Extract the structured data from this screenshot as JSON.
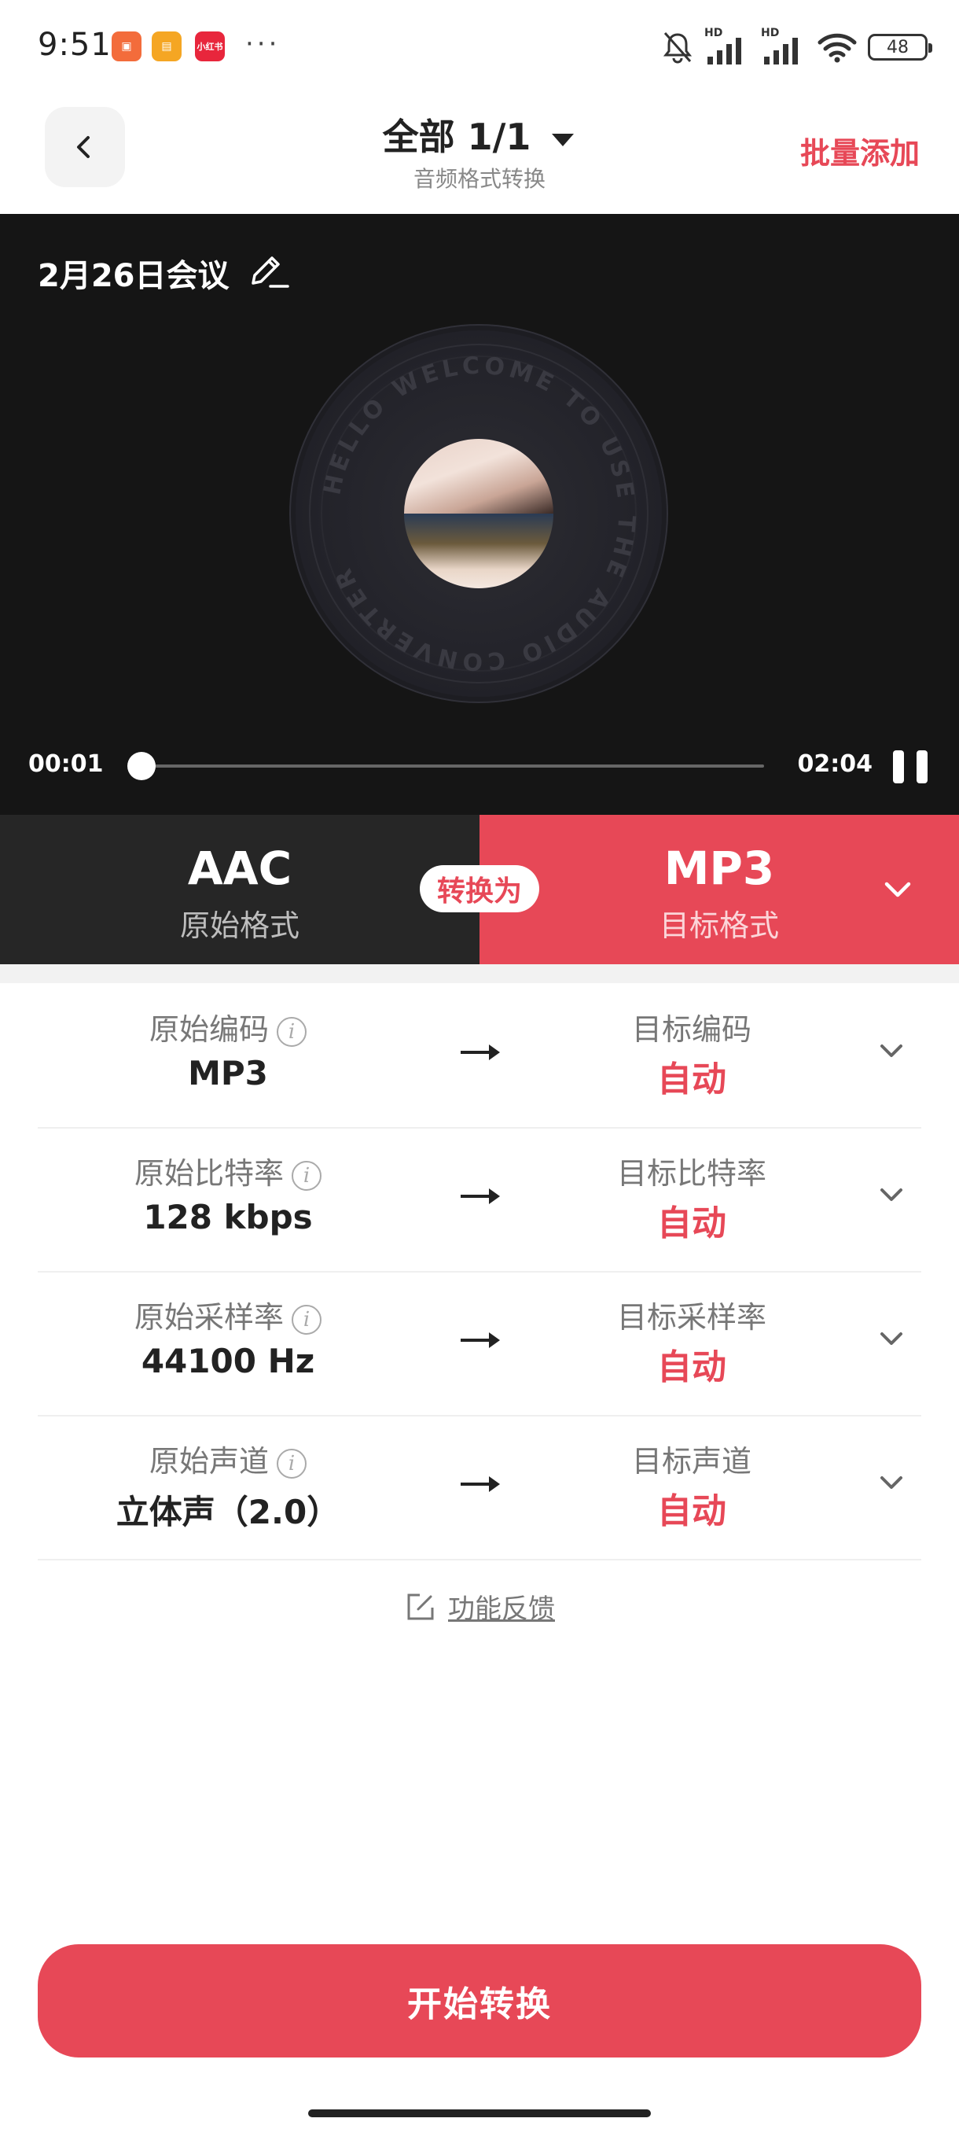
{
  "status": {
    "time": "9:51",
    "app_icon_badge": "小红书",
    "hd_label": "HD",
    "battery": "48"
  },
  "header": {
    "title": "全部 1/1",
    "subtitle": "音频格式转换",
    "batch_add": "批量添加"
  },
  "player": {
    "file_name": "2月26日会议",
    "disc_text": "HELLO WELCOME TO USE THE AUDIO CONVERTER",
    "time_current": "00:01",
    "time_total": "02:04",
    "progress_fraction": 0.008
  },
  "format": {
    "source_name": "AAC",
    "source_label": "原始格式",
    "convert_label": "转换为",
    "target_name": "MP3",
    "target_label": "目标格式"
  },
  "params": [
    {
      "label": "原始编码",
      "value": "MP3",
      "target_label": "目标编码",
      "target_value": "自动"
    },
    {
      "label": "原始比特率",
      "value": "128 kbps",
      "target_label": "目标比特率",
      "target_value": "自动"
    },
    {
      "label": "原始采样率",
      "value": "44100 Hz",
      "target_label": "目标采样率",
      "target_value": "自动"
    },
    {
      "label": "原始声道",
      "value": "立体声（2.0）",
      "target_label": "目标声道",
      "target_value": "自动"
    }
  ],
  "feedback_label": "功能反馈",
  "start_button": "开始转换",
  "colors": {
    "accent": "#e74857",
    "dark_panel": "#262626",
    "player_bg": "#151515"
  }
}
